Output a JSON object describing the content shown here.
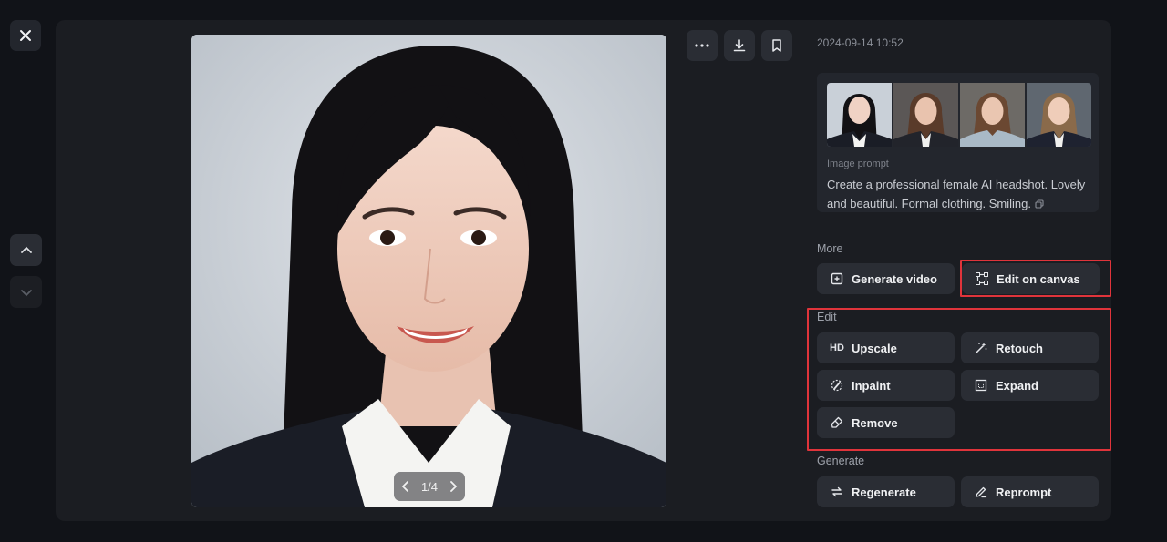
{
  "window": {
    "close_label": "close"
  },
  "image": {
    "pager_text": "1/4"
  },
  "meta": {
    "timestamp": "2024-09-14 10:52"
  },
  "prompt": {
    "label": "Image prompt",
    "text": "Create a professional female AI headshot. Lovely and beautiful. Formal clothing. Smiling.",
    "thumbnail_count": 4
  },
  "sections": {
    "more": {
      "label": "More",
      "buttons": [
        "Generate video",
        "Edit on canvas"
      ]
    },
    "edit": {
      "label": "Edit",
      "buttons": [
        "Upscale",
        "Retouch",
        "Inpaint",
        "Expand",
        "Remove"
      ],
      "hd_badge": "HD"
    },
    "generate": {
      "label": "Generate",
      "buttons": [
        "Regenerate",
        "Reprompt"
      ]
    }
  },
  "colors": {
    "background": "#111318",
    "panel": "#1b1d22",
    "button": "#2a2d34",
    "highlight": "#e0343b"
  }
}
